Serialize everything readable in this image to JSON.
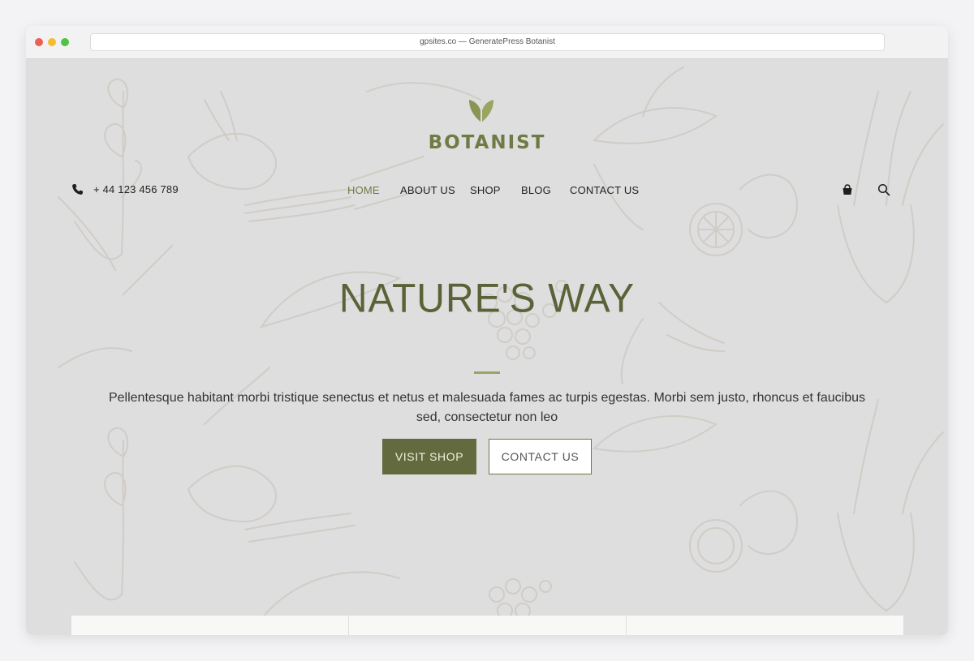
{
  "browser": {
    "address_text": "gpsites.co — GeneratePress Botanist"
  },
  "header": {
    "brand": "BOTANIST",
    "phone": "+ 44 123 456 789",
    "nav": [
      {
        "label": "HOME",
        "active": true
      },
      {
        "label": "ABOUT US",
        "active": false
      },
      {
        "label": "SHOP",
        "active": false
      },
      {
        "label": "BLOG",
        "active": false
      },
      {
        "label": "CONTACT US",
        "active": false
      }
    ],
    "icons": {
      "phone": "phone-icon",
      "cart": "shopping-bag-icon",
      "search": "search-icon",
      "logo": "leaf-logo-icon"
    }
  },
  "hero": {
    "title": "NATURE'S WAY",
    "text": "Pellentesque habitant morbi tristique senectus et netus et malesuada fames ac turpis egestas. Morbi sem justo, rhoncus et faucibus sed, consectetur non leo",
    "primary_button": "VISIT SHOP",
    "secondary_button": "CONTACT US"
  },
  "colors": {
    "accent": "#6f7b45",
    "button": "#636b3e",
    "page_background": "#dedede"
  }
}
